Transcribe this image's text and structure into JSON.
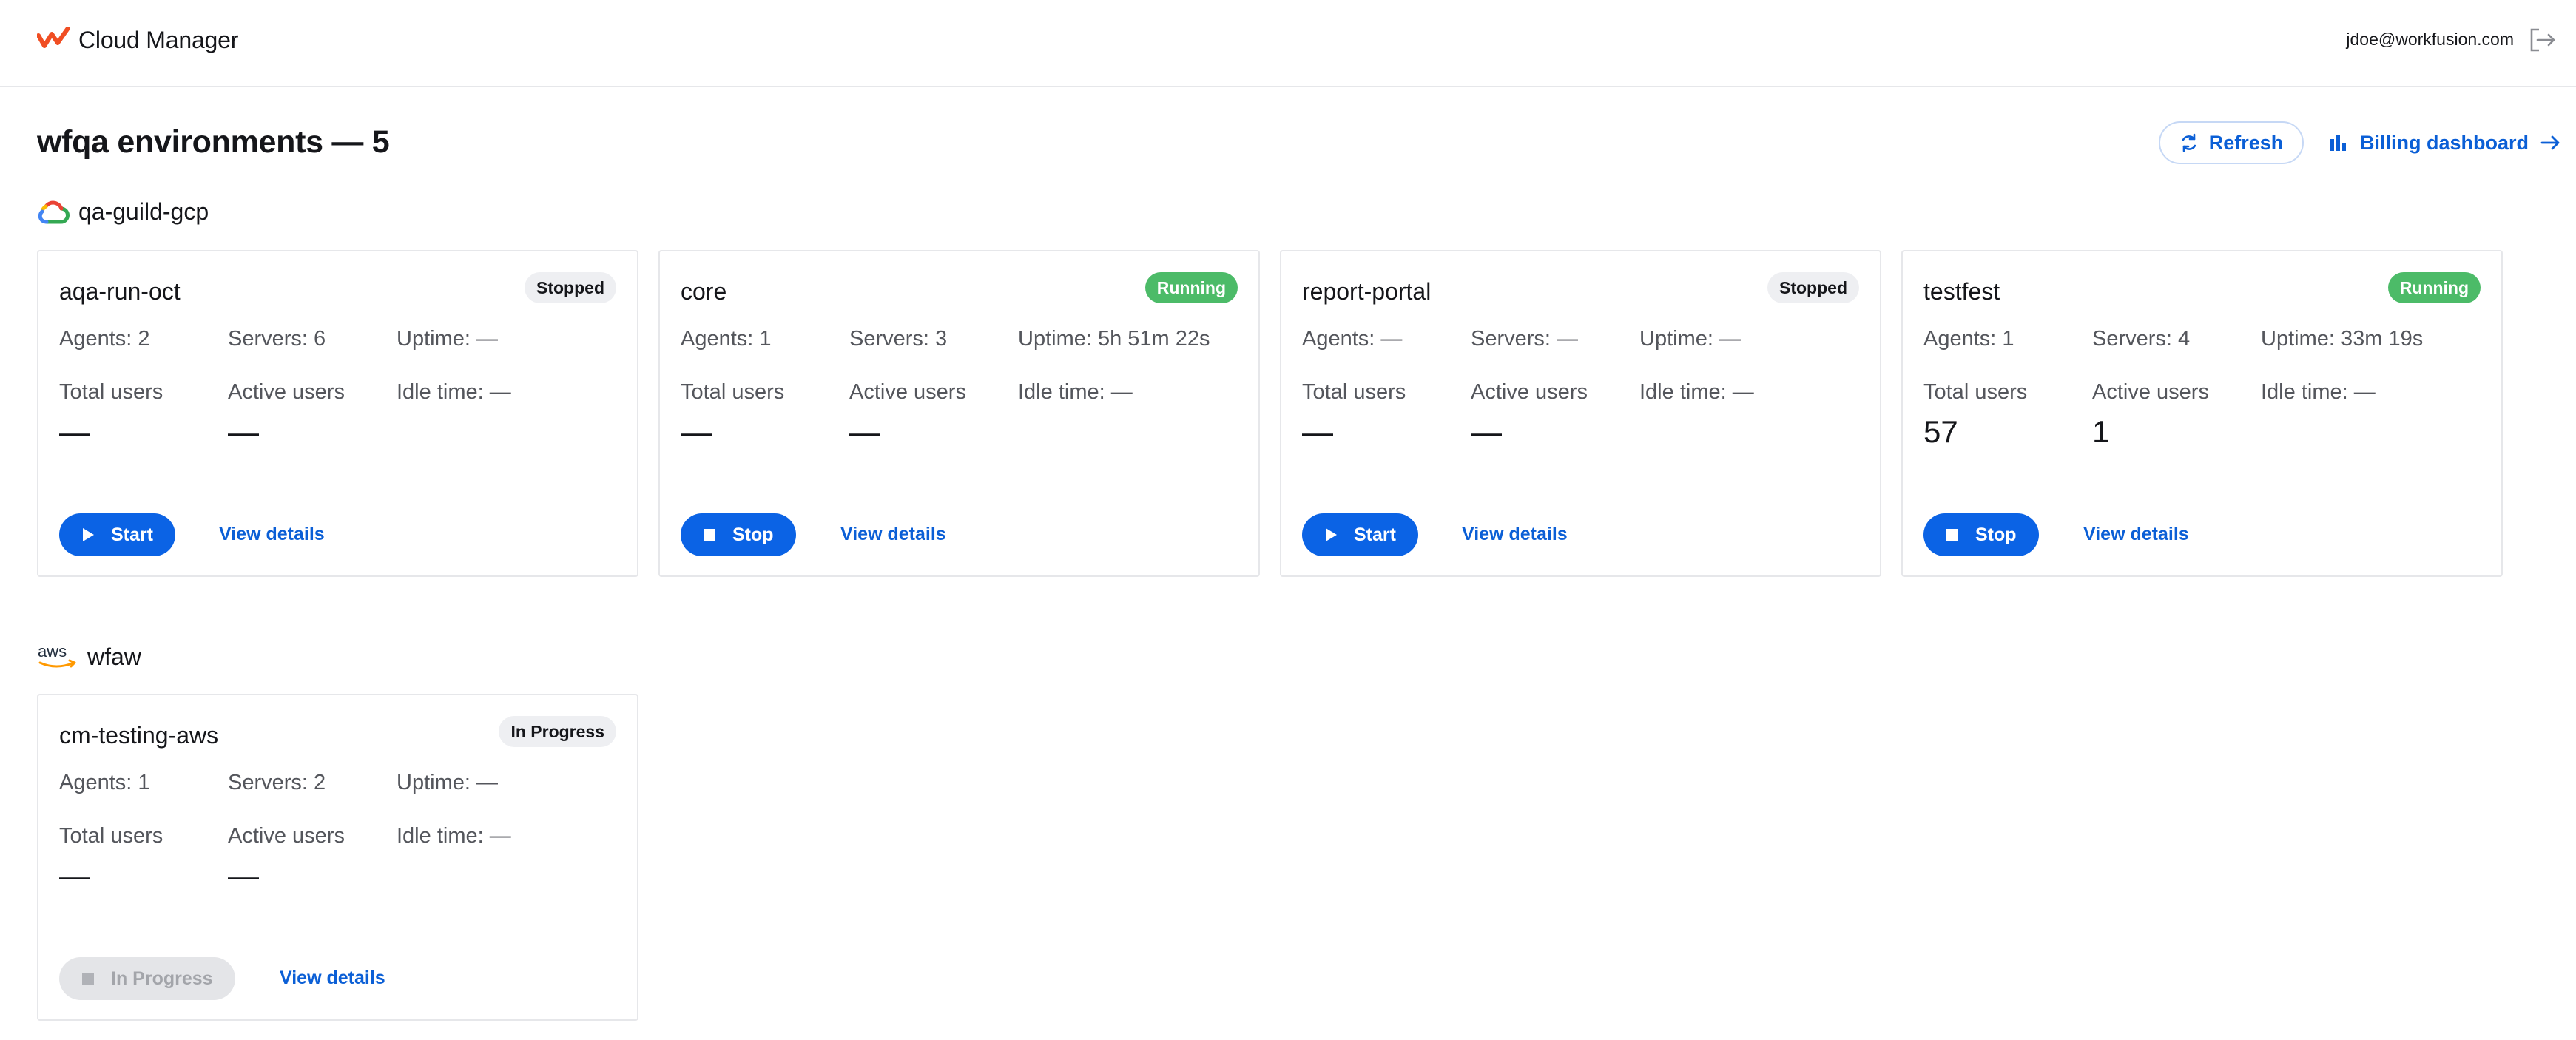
{
  "header": {
    "app_name": "Cloud Manager",
    "user_email": "jdoe@workfusion.com",
    "logo_color": "#f04e23"
  },
  "page": {
    "title": "wfqa environments — 5",
    "refresh_label": "Refresh",
    "billing_label": "Billing dashboard"
  },
  "colors": {
    "accent": "#0b63e5",
    "running": "#4cbb68",
    "stopped_badge": "#eeeff2"
  },
  "groups": [
    {
      "name": "qa-guild-gcp",
      "icon": "google-cloud-icon",
      "cards": [
        {
          "name": "aqa-run-oct",
          "status": "Stopped",
          "agents": "Agents: 2",
          "servers": "Servers: 6",
          "uptime": "Uptime: —",
          "total_label": "Total users",
          "active_label": "Active users",
          "idle": "Idle time: —",
          "total_value": "—",
          "active_value": "—",
          "action": "Start",
          "action_icon": "play-icon",
          "view": "View details"
        },
        {
          "name": "core",
          "status": "Running",
          "agents": "Agents: 1",
          "servers": "Servers: 3",
          "uptime": "Uptime: 5h 51m 22s",
          "total_label": "Total users",
          "active_label": "Active users",
          "idle": "Idle time: —",
          "total_value": "—",
          "active_value": "—",
          "action": "Stop",
          "action_icon": "stop-icon",
          "view": "View details"
        },
        {
          "name": "report-portal",
          "status": "Stopped",
          "agents": "Agents: —",
          "servers": "Servers: —",
          "uptime": "Uptime: —",
          "total_label": "Total users",
          "active_label": "Active users",
          "idle": "Idle time: —",
          "total_value": "—",
          "active_value": "—",
          "action": "Start",
          "action_icon": "play-icon",
          "view": "View details"
        },
        {
          "name": "testfest",
          "status": "Running",
          "agents": "Agents: 1",
          "servers": "Servers: 4",
          "uptime": "Uptime: 33m 19s",
          "total_label": "Total users",
          "active_label": "Active users",
          "idle": "Idle time: —",
          "total_value": "57",
          "active_value": "1",
          "action": "Stop",
          "action_icon": "stop-icon",
          "view": "View details"
        }
      ]
    },
    {
      "name": "wfaw",
      "icon": "aws-icon",
      "icon_text": "aws",
      "cards": [
        {
          "name": "cm-testing-aws",
          "status": "In Progress",
          "agents": "Agents: 1",
          "servers": "Servers: 2",
          "uptime": "Uptime: —",
          "total_label": "Total users",
          "active_label": "Active users",
          "idle": "Idle time: —",
          "total_value": "—",
          "active_value": "—",
          "action": "In Progress",
          "action_icon": "stop-icon",
          "view": "View details"
        }
      ]
    }
  ]
}
